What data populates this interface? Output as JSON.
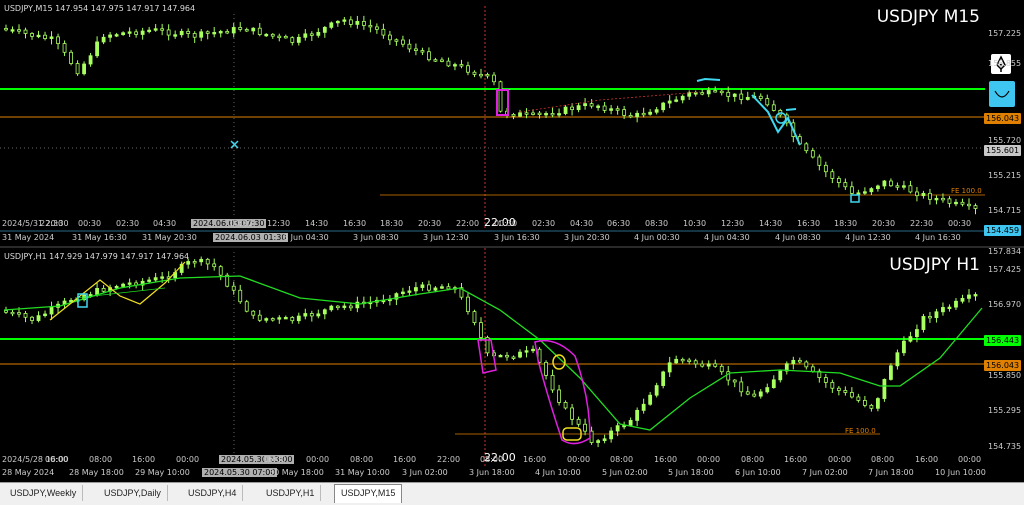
{
  "top_pane": {
    "info": "USDJPY,M15  147.954 147.975 147.917 147.964",
    "title": "USDJPY M15",
    "y_labels": [
      {
        "text": "157.225",
        "cls": "w"
      },
      {
        "text": "156.855",
        "cls": "w"
      },
      {
        "text": "156.043",
        "cls": "orange"
      },
      {
        "text": "155.720",
        "cls": "w"
      },
      {
        "text": "155.601",
        "cls": "gray"
      },
      {
        "text": "155.215",
        "cls": "w"
      },
      {
        "text": "154.715",
        "cls": "w"
      },
      {
        "text": "154.459",
        "cls": "blue"
      }
    ],
    "x_labels_row1": [
      "2024/5/31 20:30",
      "22:30",
      "00:30",
      "02:30",
      "04:30",
      "2024.06.03 07:30",
      "10:30",
      "12:30",
      "14:30",
      "16:30",
      "18:30",
      "20:30",
      "22:00",
      "00:30",
      "02:30",
      "04:30",
      "06:30",
      "08:30",
      "10:30",
      "12:30",
      "14:30",
      "16:30",
      "18:30",
      "20:30",
      "22:30",
      "00:30"
    ],
    "x_labels_row2": [
      "31 May 2024",
      "31 May 16:30",
      "31 May 20:30",
      "2024.06.03 01:30",
      "3 Jun 04:30",
      "3 Jun 08:30",
      "3 Jun 12:30",
      "3 Jun 16:30",
      "3 Jun 20:30",
      "4 Jun 00:30",
      "4 Jun 04:30",
      "4 Jun 08:30",
      "4 Jun 12:30",
      "4 Jun 16:30"
    ],
    "fe_label": "FE 100.0",
    "cursor_time": "22:00"
  },
  "bottom_pane": {
    "info": "USDJPY,H1  147.929 147.979 147.917 147.964",
    "title": "USDJPY H1",
    "y_labels": [
      {
        "text": "157.834",
        "cls": "w"
      },
      {
        "text": "157.425",
        "cls": "w"
      },
      {
        "text": "156.970",
        "cls": "w"
      },
      {
        "text": "156.443",
        "cls": "green"
      },
      {
        "text": "156.043",
        "cls": "orange"
      },
      {
        "text": "155.850",
        "cls": "w"
      },
      {
        "text": "155.295",
        "cls": "w"
      },
      {
        "text": "154.735",
        "cls": "w"
      }
    ],
    "x_labels_row1": [
      "2024/5/28 16:00",
      "00:00",
      "08:00",
      "16:00",
      "00:00",
      "2024.05.30 13:00",
      "16:00",
      "00:00",
      "08:00",
      "16:00",
      "22:00",
      "08:00",
      "16:00",
      "00:00",
      "08:00",
      "16:00",
      "00:00",
      "08:00",
      "16:00",
      "00:00",
      "08:00",
      "16:00",
      "00:00"
    ],
    "x_labels_row2": [
      "28 May 2024",
      "28 May 18:00",
      "29 May 10:00",
      "2024.05.30 07:00",
      "30 May 18:00",
      "31 May 10:00",
      "3 Jun 02:00",
      "3 Jun 18:00",
      "4 Jun 10:00",
      "5 Jun 02:00",
      "5 Jun 18:00",
      "6 Jun 10:00",
      "7 Jun 02:00",
      "7 Jun 18:00",
      "10 Jun 10:00"
    ],
    "fe_label": "FE 100.0",
    "cursor_time": "22:00"
  },
  "tabs": [
    "USDJPY,Weekly",
    "USDJPY,Daily",
    "USDJPY,H4",
    "USDJPY,H1",
    "USDJPY,M15"
  ],
  "active_tab": "USDJPY,M15",
  "colors": {
    "candle": "#a8ff60",
    "ma": "#22dd22",
    "hline": "#00ff00",
    "orange": "#e08000",
    "cyan": "#40d8f0",
    "magenta": "#e020e0",
    "yellow": "#f0e020",
    "tag_blue": "#3ec6f0"
  },
  "icons": {
    "top_right_1": "pen-nib-icon",
    "top_right_2": "smile-cup-icon",
    "crosshair": "cross-marker-icon"
  }
}
